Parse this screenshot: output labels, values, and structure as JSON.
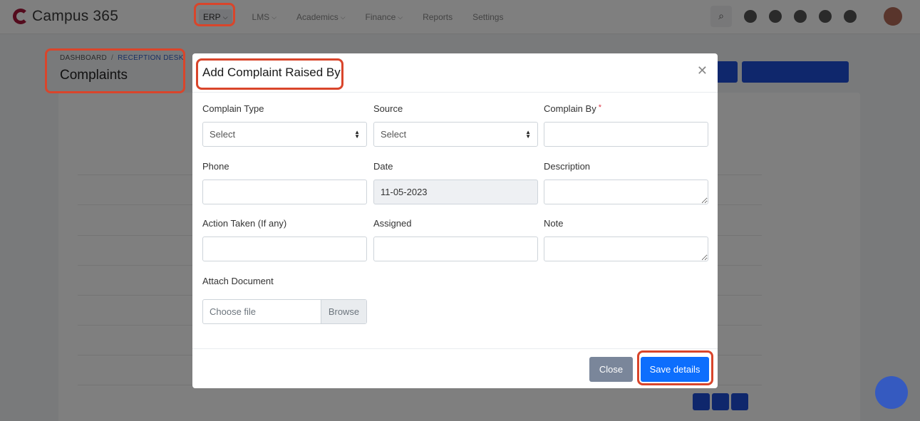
{
  "app": {
    "name": "Campus 365"
  },
  "nav": {
    "items": [
      {
        "label": "ERP",
        "active": true
      },
      {
        "label": "LMS"
      },
      {
        "label": "Academics"
      },
      {
        "label": "Finance"
      },
      {
        "label": "Reports"
      },
      {
        "label": "Settings"
      }
    ]
  },
  "breadcrumb": {
    "root": "DASHBOARD",
    "separator": "/",
    "current": "RECEPTION DESK"
  },
  "page": {
    "title": "Complaints"
  },
  "modal": {
    "title": "Add Complaint Raised By",
    "close_symbol": "✕",
    "fields": {
      "complain_type": {
        "label": "Complain Type",
        "value": "Select"
      },
      "source": {
        "label": "Source",
        "value": "Select"
      },
      "complain_by": {
        "label": "Complain By",
        "required_mark": "*",
        "value": ""
      },
      "phone": {
        "label": "Phone",
        "value": ""
      },
      "date": {
        "label": "Date",
        "value": "11-05-2023"
      },
      "description": {
        "label": "Description",
        "value": ""
      },
      "action_taken": {
        "label": "Action Taken (If any)",
        "value": ""
      },
      "assigned": {
        "label": "Assigned",
        "value": ""
      },
      "note": {
        "label": "Note",
        "value": ""
      },
      "attach": {
        "label": "Attach Document",
        "placeholder": "Choose file",
        "browse_label": "Browse"
      }
    },
    "footer": {
      "close_label": "Close",
      "save_label": "Save details"
    }
  },
  "colors": {
    "primary": "#0d6efd",
    "secondary": "#7a869a",
    "brand": "#a8163a",
    "highlight": "#d9452b"
  }
}
